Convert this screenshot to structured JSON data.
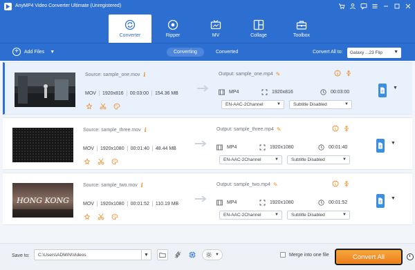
{
  "app": {
    "title": "AnyMP4 Video Converter Ultimate (Unregistered)"
  },
  "nav": {
    "tabs": [
      {
        "label": "Converter",
        "icon": "converter-icon",
        "active": true
      },
      {
        "label": "Ripper",
        "icon": "ripper-icon",
        "active": false
      },
      {
        "label": "MV",
        "icon": "mv-icon",
        "active": false
      },
      {
        "label": "Collage",
        "icon": "collage-icon",
        "active": false
      },
      {
        "label": "Toolbox",
        "icon": "toolbox-icon",
        "active": false
      }
    ]
  },
  "toolbar": {
    "add_files": "Add Files",
    "tab_converting": "Converting",
    "tab_converted": "Converted",
    "convert_all_to": "Convert All to:",
    "profile": "Galaxy ...23 Flip"
  },
  "files": [
    {
      "source": "Source: sample_one.mov",
      "format": "MOV",
      "resolution": "1920x816",
      "duration": "00:03:00",
      "size": "154.36 MB",
      "output": "Output: sample_one.mp4",
      "out_format": "MP4",
      "out_resolution": "1920x816",
      "out_duration": "00:03:00",
      "audio": "EN-AAC-2Channel",
      "subtitle": "Subtitle Disabled"
    },
    {
      "source": "Source: sample_three.mov",
      "format": "MOV",
      "resolution": "1920x1080",
      "duration": "00:01:40",
      "size": "48.44 MB",
      "output": "Output: sample_three.mp4",
      "out_format": "MP4",
      "out_resolution": "1920x1080",
      "out_duration": "00:01:40",
      "audio": "EN-AAC-2Channel",
      "subtitle": "Subtitle Disabled"
    },
    {
      "source": "Source: sample_two.mov",
      "format": "MOV",
      "resolution": "1920x1080",
      "duration": "00:01:52",
      "size": "110.19 MB",
      "output": "Output: sample_two.mp4",
      "out_format": "MP4",
      "out_resolution": "1920x1080",
      "out_duration": "00:01:52",
      "audio": "EN-AAC-2Channel",
      "subtitle": "Subtitle Disabled",
      "thumb_text": "HONG KONG"
    }
  ],
  "footer": {
    "save_to": "Save to:",
    "path": "C:\\Users\\ADMIN\\Videos",
    "merge": "Merge into one file",
    "convert_all": "Convert All"
  },
  "colors": {
    "brand_blue": "#2d6fd0",
    "accent_orange": "#f08a24",
    "convert_button": "#ee7e1c"
  }
}
